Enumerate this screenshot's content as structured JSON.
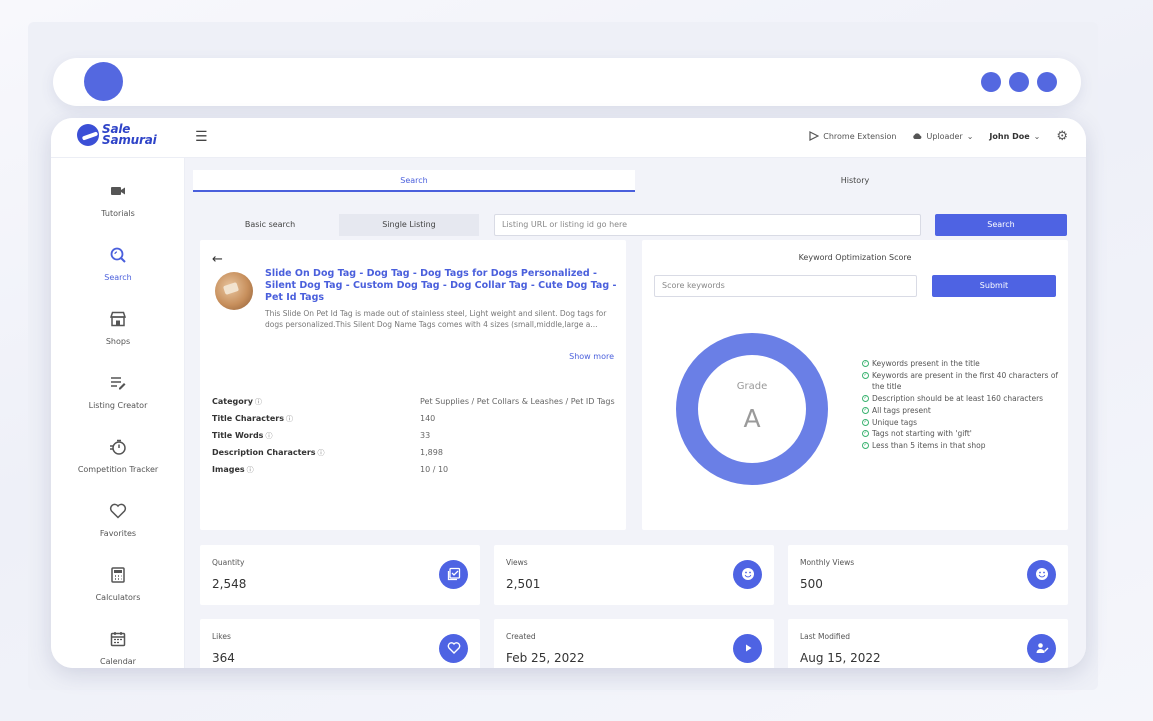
{
  "colors": {
    "accent": "#4e63e3",
    "success": "#3cb371"
  },
  "brand": {
    "line1": "Sale",
    "line2": "Samurai"
  },
  "topbar": {
    "chrome_extension": "Chrome Extension",
    "uploader": "Uploader",
    "user": "John Doe"
  },
  "sidebar": {
    "items": [
      {
        "label": "Tutorials",
        "icon": "video-camera-icon"
      },
      {
        "label": "Search",
        "icon": "search-icon"
      },
      {
        "label": "Shops",
        "icon": "store-icon"
      },
      {
        "label": "Listing Creator",
        "icon": "list-edit-icon"
      },
      {
        "label": "Competition Tracker",
        "icon": "stopwatch-icon"
      },
      {
        "label": "Favorites",
        "icon": "heart-icon"
      },
      {
        "label": "Calculators",
        "icon": "calculator-icon"
      },
      {
        "label": "Calendar",
        "icon": "calendar-icon"
      }
    ]
  },
  "tabs": {
    "search": "Search",
    "history": "History"
  },
  "search_bar": {
    "basic": "Basic search",
    "single": "Single Listing",
    "placeholder": "Listing URL or listing id go here",
    "button": "Search"
  },
  "listing": {
    "title": "Slide On Dog Tag - Dog Tag - Dog Tags for Dogs Personalized - Silent Dog Tag - Custom Dog Tag - Dog Collar Tag - Cute Dog Tag - Pet Id Tags",
    "description": "This Slide On Pet Id Tag is made out of stainless steel, Light weight and silent. Dog tags for dogs personalized.This Silent Dog Name Tags comes with 4 sizes (small,middle,large a...",
    "show_more": "Show more",
    "stats": [
      {
        "label": "Category",
        "value": "Pet Supplies / Pet Collars & Leashes / Pet ID Tags"
      },
      {
        "label": "Title Characters",
        "value": "140"
      },
      {
        "label": "Title Words",
        "value": "33"
      },
      {
        "label": "Description Characters",
        "value": "1,898"
      },
      {
        "label": "Images",
        "value": "10 / 10"
      }
    ]
  },
  "score": {
    "title": "Keyword Optimization Score",
    "placeholder": "Score keywords",
    "submit": "Submit",
    "grade_label": "Grade",
    "grade": "A",
    "criteria": [
      "Keywords present in the title",
      "Keywords are present in the first 40 characters of the title",
      "Description should be at least 160 characters",
      "All tags present",
      "Unique tags",
      "Tags not starting with 'gift'",
      "Less than 5 items in that shop"
    ]
  },
  "metrics": [
    {
      "label": "Quantity",
      "value": "2,548",
      "icon": "checklist-icon"
    },
    {
      "label": "Views",
      "value": "2,501",
      "icon": "smiley-icon"
    },
    {
      "label": "Monthly Views",
      "value": "500",
      "icon": "smiley-icon"
    },
    {
      "label": "Likes",
      "value": "364",
      "icon": "heart-icon"
    },
    {
      "label": "Created",
      "value": "Feb 25, 2022",
      "icon": "play-icon"
    },
    {
      "label": "Last Modified",
      "value": "Aug 15, 2022",
      "icon": "user-edit-icon"
    }
  ]
}
